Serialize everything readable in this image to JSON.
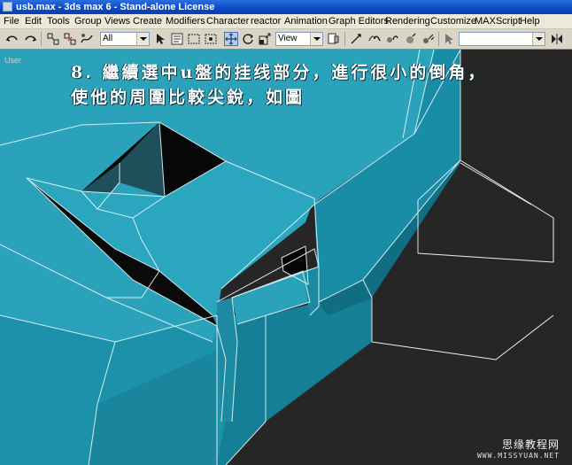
{
  "window": {
    "title": "usb.max - 3ds max 6 - Stand-alone License"
  },
  "menu": {
    "items": [
      "File",
      "Edit",
      "Tools",
      "Group",
      "Views",
      "Create",
      "Modifiers",
      "Character",
      "reactor",
      "Animation",
      "Graph Editors",
      "Rendering",
      "Customize",
      "MAXScript",
      "Help"
    ]
  },
  "toolbar": {
    "selection_filter": "All",
    "reference_coord": "View",
    "named_selection": ""
  },
  "viewport": {
    "label": "User",
    "background_color": "#262626",
    "model_color": "#2aa0b8"
  },
  "caption": {
    "line1": "8.  繼續選中u盤的挂线部分，進行很小的倒角，",
    "line2": "使他的周圍比較尖銳，如圖"
  },
  "watermark": {
    "cn": "思缘教程网",
    "url": "WWW.MISSYUAN.NET"
  }
}
